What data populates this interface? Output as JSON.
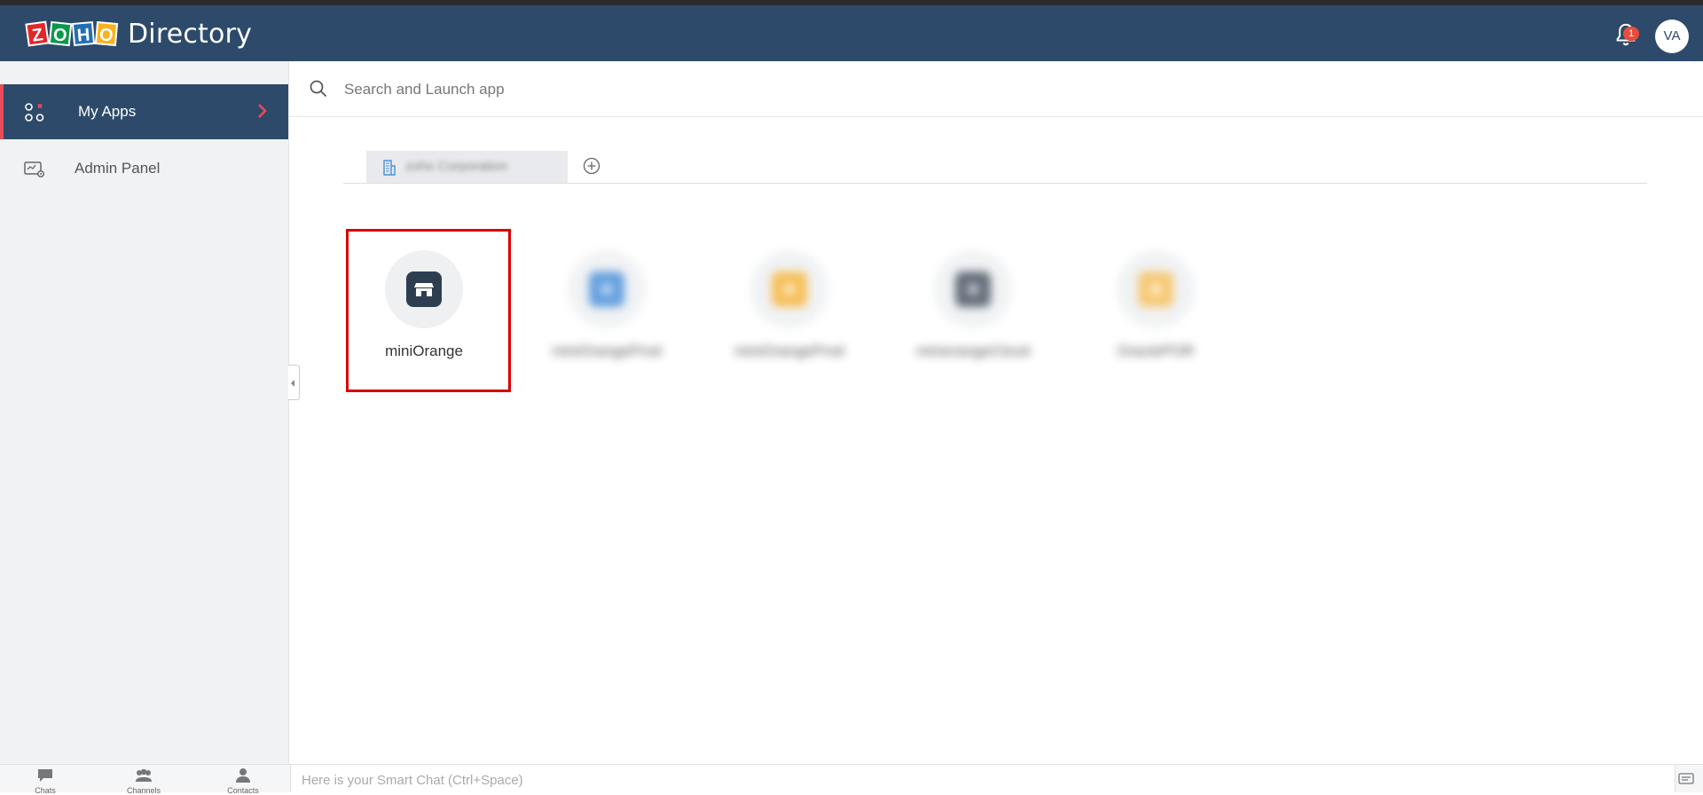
{
  "header": {
    "logo_letters": [
      "Z",
      "O",
      "H",
      "O"
    ],
    "product_name": "Directory",
    "notification_count": "1",
    "avatar_initials": "VA"
  },
  "sidebar": {
    "items": [
      {
        "label": "My Apps",
        "icon": "apps-icon",
        "active": true
      },
      {
        "label": "Admin Panel",
        "icon": "admin-panel-icon",
        "active": false
      }
    ]
  },
  "search": {
    "placeholder": "Search and Launch app"
  },
  "tabs": {
    "org_tab_label": "zoho Corporation"
  },
  "apps": [
    {
      "label": "miniOrange",
      "tile_color": "#2d3e50",
      "highlighted": true
    },
    {
      "label": "miniOrangeProd",
      "tile_color": "#4a90d9",
      "blurred": true
    },
    {
      "label": "miniOrangeProd",
      "tile_color": "#f5b63e",
      "blurred": true
    },
    {
      "label": "miniorangeCloud",
      "tile_color": "#4a5563",
      "blurred": true
    },
    {
      "label": "OraclePOR",
      "tile_color": "#f5c15e",
      "blurred": true
    }
  ],
  "bottombar": {
    "items": [
      "Chats",
      "Channels",
      "Contacts"
    ],
    "smartchat_placeholder": "Here is your Smart Chat (Ctrl+Space)"
  },
  "colors": {
    "header_bg": "#2d4a6b",
    "active_accent": "#e74c5a",
    "highlight_border": "#d90000"
  }
}
